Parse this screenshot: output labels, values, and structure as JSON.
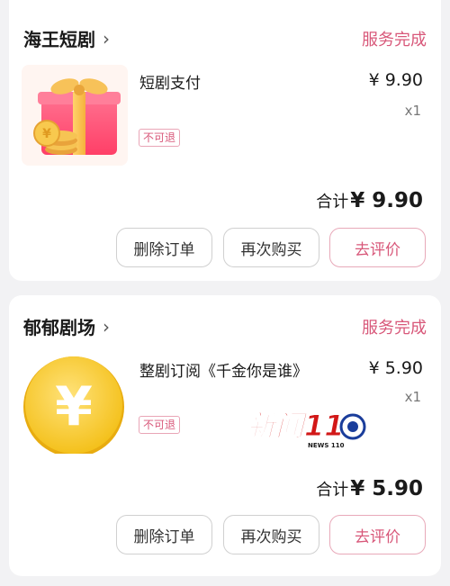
{
  "orders": [
    {
      "shop_name": "海王短剧",
      "status": "服务完成",
      "product_name": "短剧支付",
      "price": "¥ 9.90",
      "quantity": "x1",
      "tag": "不可退",
      "total_label": "合计",
      "total_amount": "¥ 9.90",
      "buttons": {
        "delete": "删除订单",
        "rebuy": "再次购买",
        "review": "去评价"
      }
    },
    {
      "shop_name": "郁郁剧场",
      "status": "服务完成",
      "product_name": "整剧订阅《千金你是谁》",
      "price": "¥ 5.90",
      "quantity": "x1",
      "tag": "不可退",
      "total_label": "合计",
      "total_amount": "¥ 5.90",
      "buttons": {
        "delete": "删除订单",
        "rebuy": "再次购买",
        "review": "去评价"
      },
      "overlay_logo": {
        "main": "新闻110",
        "sub": "NEWS 110"
      }
    }
  ],
  "icons": {
    "chevron": "chevron-right-icon",
    "gift": "gift-box-icon",
    "coin": "yuan-coin-icon"
  },
  "colors": {
    "accent": "#d8587a",
    "background": "#f2f2f4"
  }
}
